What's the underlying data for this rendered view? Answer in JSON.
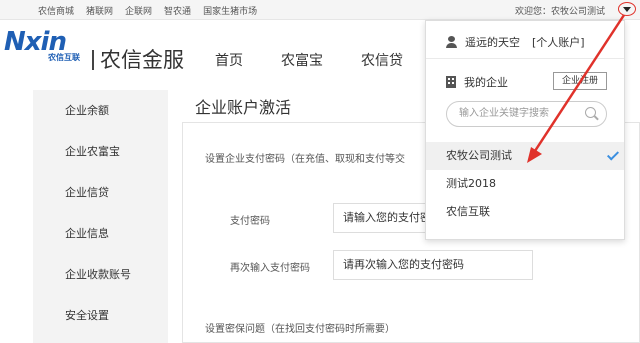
{
  "topbar": {
    "links": [
      "农信商城",
      "猪联网",
      "企联网",
      "智农通",
      "国家生猪市场"
    ],
    "welcome": "欢迎您：农牧公司测试"
  },
  "header": {
    "logo_text": "Nxin",
    "logo_sub": "农信互联",
    "brand": "农信金服",
    "nav": [
      "首页",
      "农富宝",
      "农信贷"
    ]
  },
  "sidebar": {
    "items": [
      "企业余额",
      "企业农富宝",
      "企业信贷",
      "企业信息",
      "企业收款账号",
      "安全设置"
    ]
  },
  "main": {
    "page_title": "企业账户激活",
    "section1": "设置企业支付密码（在充值、取现和支付等交",
    "pay_pwd_label": "支付密码",
    "pay_pwd_placeholder": "请输入您的支付密码",
    "repeat_pwd_label": "再次输入支付密码",
    "repeat_pwd_placeholder": "请再次输入您的支付密码",
    "section2": "设置密保问题（在找回支付密码时所需要）"
  },
  "dropdown": {
    "username": "遥远的天空",
    "personal_account": "[个人账户]",
    "my_corp": "我的企业",
    "register_btn": "企业注册",
    "search_placeholder": "输入企业关键字搜索",
    "companies": [
      "农牧公司测试",
      "测试2018",
      "农信互联"
    ],
    "selected_index": 0
  },
  "colors": {
    "accent_red": "#e0322b",
    "brand_blue": "#1f5fb4",
    "check_blue": "#3b8fe0"
  }
}
